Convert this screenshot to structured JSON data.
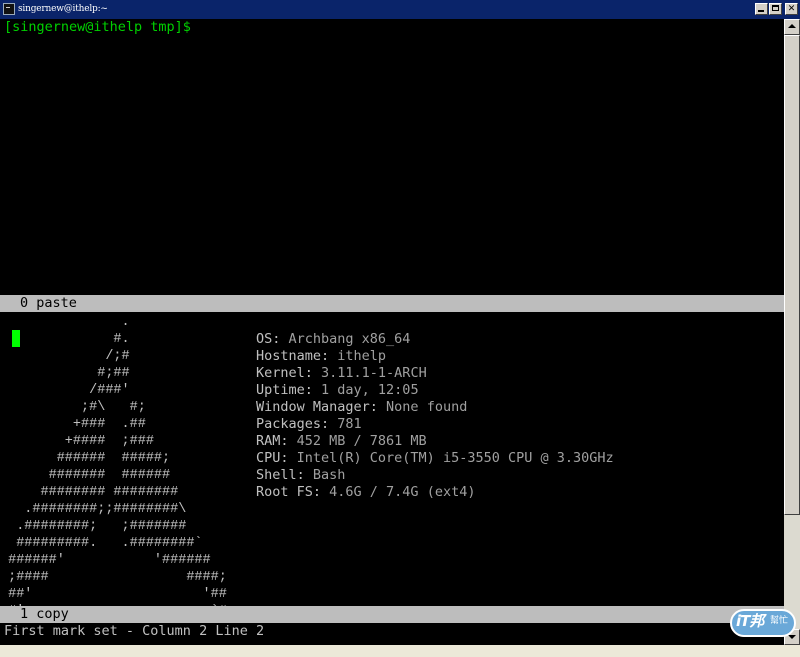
{
  "window": {
    "title": "singernew@ithelp:~"
  },
  "terminal": {
    "prompt": "[singernew@ithelp tmp]$",
    "status_top": "0 paste",
    "status_bottom": "1 copy",
    "message": "First mark set - Column 2 Line 2",
    "ascii_art": [
      "               .",
      "              #.",
      "             /;#",
      "            #;##",
      "           /###'",
      "          ;#\\   #;",
      "         +###  .##",
      "        +####  ;###",
      "       ######  #####;",
      "      #######  ######",
      "     ######## ########",
      "   .########;;########\\",
      "  .########;   ;#######",
      "  #########.   .########`",
      " ######'           '######",
      " ;####                 ####;",
      " ##'                     '##",
      " #'                       `#"
    ],
    "sysinfo": [
      {
        "key": "OS:",
        "value": " Archbang x86_64"
      },
      {
        "key": "Hostname:",
        "value": " ithelp"
      },
      {
        "key": "Kernel:",
        "value": " 3.11.1-1-ARCH"
      },
      {
        "key": "Uptime:",
        "value": " 1 day, 12:05"
      },
      {
        "key": "Window Manager:",
        "value": " None found"
      },
      {
        "key": "Packages:",
        "value": " 781"
      },
      {
        "key": "RAM:",
        "value": " 452 MB / 7861 MB"
      },
      {
        "key": "CPU:",
        "value": " Intel(R) Core(TM) i5-3550 CPU @ 3.30GHz"
      },
      {
        "key": "Shell:",
        "value": " Bash"
      },
      {
        "key": "Root FS:",
        "value": " 4.6G / 7.4G (ext4)"
      }
    ]
  },
  "logo": {
    "text": "iT邦",
    "subtext": "幫忙"
  },
  "colors": {
    "titlebar": "#0a246a",
    "terminal_bg": "#000000",
    "prompt": "#00d000",
    "cursor": "#00ff00",
    "statusbar": "#bdbdbd"
  }
}
